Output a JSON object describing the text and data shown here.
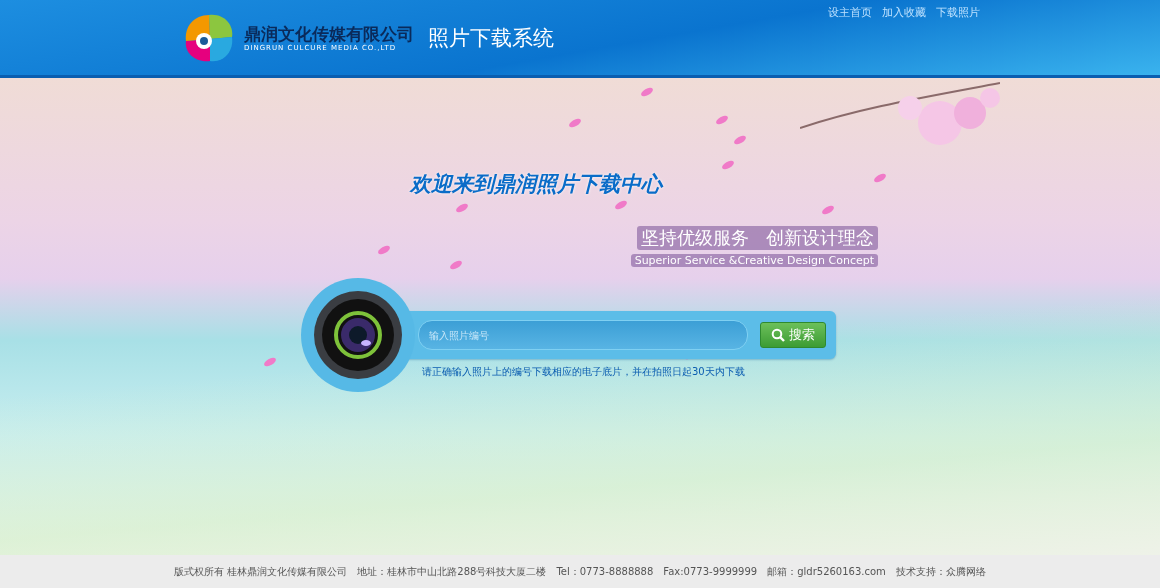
{
  "header": {
    "company_name": "鼎润文化传媒有限公司",
    "company_name_en": "DINGRUN CULCURE MEDIA CO.,LTD",
    "system_title": "照片下载系统",
    "links": [
      "设主首页",
      "加入收藏",
      "下载照片"
    ]
  },
  "hero": {
    "welcome": "欢迎来到**鼎润**照片下载中心",
    "slogan": "坚持优级服务   创新设计理念",
    "slogan_en": "Superior Service &Creative Design Concept"
  },
  "search": {
    "placeholder": "输入照片编号",
    "button": "搜索",
    "hint": "请正确输入照片上的编号下载相应的电子底片，并在拍照日起30天内下载"
  },
  "footer": [
    "版式权所有 桂林鼎润文化传媒有限公司",
    "地址：桂林市中山北路288号科技大厦二楼",
    "Tel：0773-8888888",
    "Fax:0773-9999999",
    "邮箱：gldr5260163.com",
    "技术支持：众腾网络"
  ]
}
